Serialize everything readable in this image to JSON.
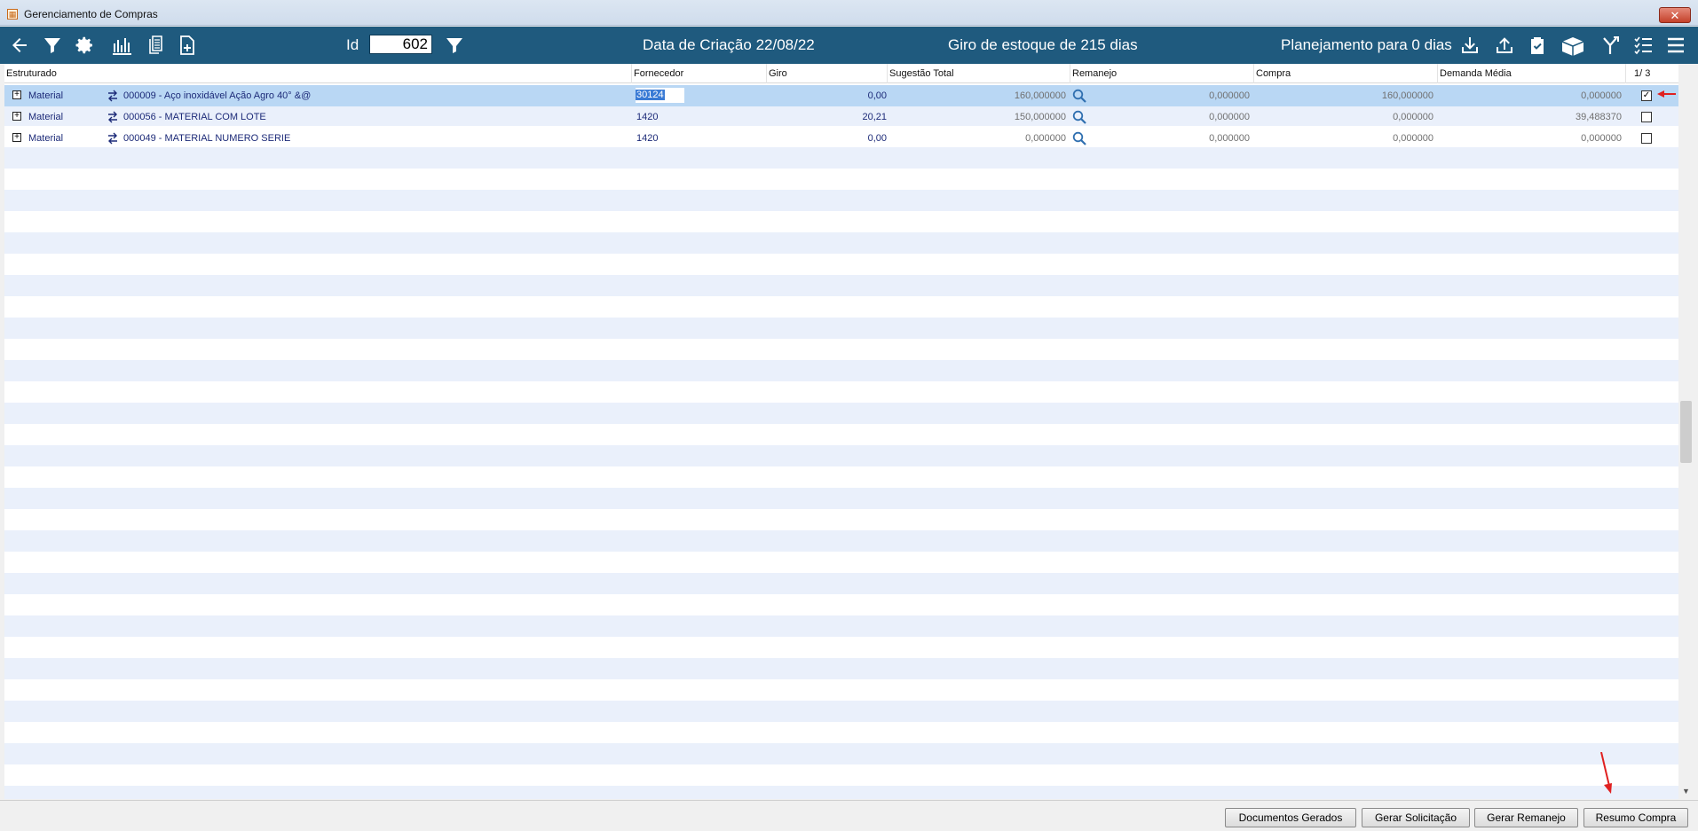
{
  "window": {
    "title": "Gerenciamento de Compras",
    "close_label": "✕"
  },
  "toolbar": {
    "id_label": "Id",
    "id_value": "602",
    "creation_date": "Data de Criação 22/08/22",
    "stock_turnover": "Giro de estoque de  215 dias",
    "planning": "Planejamento para 0 dias"
  },
  "grid": {
    "headers": {
      "estruturado": "Estruturado",
      "fornecedor": "Fornecedor",
      "giro": "Giro",
      "sugestao_total": "Sugestão Total",
      "remanejo": "Remanejo",
      "compra": "Compra",
      "demanda_media": "Demanda Média",
      "page_counter": "1/  3"
    },
    "rows": [
      {
        "type": "Material",
        "description": "000009 - Aço inoxidável Ação Agro 40° &@",
        "fornecedor": "30124",
        "giro": "0,00",
        "sugestao_total": "160,000000",
        "remanejo": "0,000000",
        "compra": "160,000000",
        "demanda_media": "0,000000",
        "checked": true
      },
      {
        "type": "Material",
        "description": "000056 - MATERIAL  COM LOTE",
        "fornecedor": "1420",
        "giro": "20,21",
        "sugestao_total": "150,000000",
        "remanejo": "0,000000",
        "compra": "0,000000",
        "demanda_media": "39,488370",
        "checked": false
      },
      {
        "type": "Material",
        "description": "000049 - MATERIAL NUMERO SERIE",
        "fornecedor": "1420",
        "giro": "0,00",
        "sugestao_total": "0,000000",
        "remanejo": "0,000000",
        "compra": "0,000000",
        "demanda_media": "0,000000",
        "checked": false
      }
    ]
  },
  "buttons": {
    "documentos_gerados": "Documentos Gerados",
    "gerar_solicitacao": "Gerar Solicitação",
    "gerar_remanejo": "Gerar Remanejo",
    "resumo_compra": "Resumo Compra"
  },
  "colors": {
    "toolbar": "#1f5a7e",
    "row_selected": "#b9d7f4",
    "stripe": "#eaf0fb",
    "annotation": "#e02020"
  }
}
